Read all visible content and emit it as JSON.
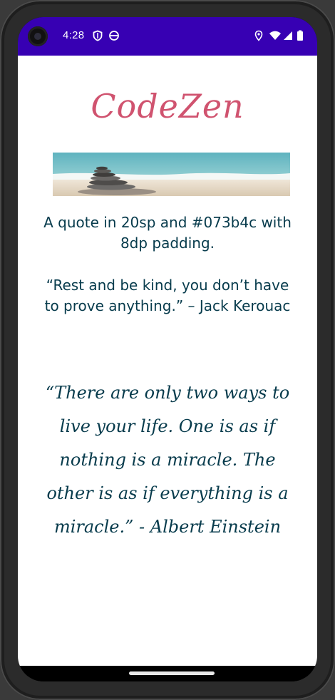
{
  "status_bar": {
    "time": "4:28",
    "left_icons": [
      "shield-icon",
      "face-icon"
    ],
    "right_icons": [
      "location-icon",
      "wifi-icon",
      "cellular-icon",
      "battery-icon"
    ],
    "color": "#3700b3"
  },
  "app": {
    "title": "CodeZen",
    "title_color": "#d0536f",
    "quote_intro": "A quote in 20sp and #073b4c with 8dp padding.",
    "quote_kerouac": "“Rest and be kind, you don’t have to prove anything.” – Jack Kerouac",
    "quote_einstein": "“There are only two ways to live your life. One is as if nothing is a miracle. The other is as if everything is a miracle.” - Albert Einstein",
    "text_color": "#073b4c",
    "banner_image": "beach-stacked-stones-image"
  }
}
